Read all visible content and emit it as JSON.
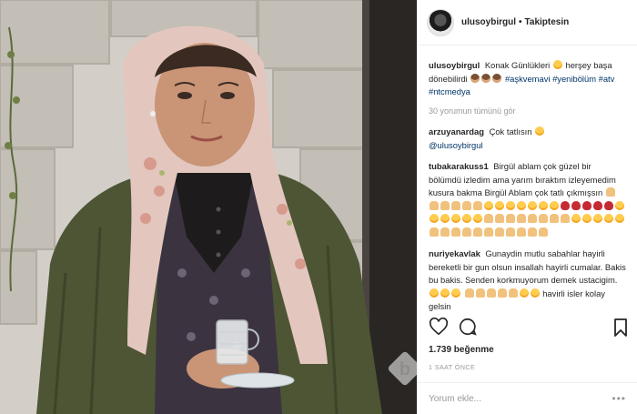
{
  "post": {
    "username": "ulusoybirgul",
    "dot": "•",
    "follow_status": "Takiptesin"
  },
  "caption": {
    "username": "ulusoybirgul",
    "text": "Konak Günlükleri",
    "text2": "herşey başa dönebilirdi",
    "tags": "#aşkvemavi #yenibölüm #atv #ntcmedya"
  },
  "view_all": "30 yorumun tümünü gör",
  "comments": [
    {
      "user": "arzuyanardag",
      "text": "Çok tatlısın",
      "mention": "@ulusoybirgul"
    },
    {
      "user": "tubakarakuss1",
      "text": "Birgül ablam çok güzel bir bölümdü izledim ama yarım bıraktım izleyemedim kusura bakma Birgül Ablam çok tatlı çıkmışsın"
    },
    {
      "user": "nuriyekavlak",
      "text": "Gunaydin mutlu sabahlar hayirli bereketli bir gun olsun insallah hayirli cumalar. Bakis bu bakis. Senden korkmuyorum demek ustacigim.",
      "text2": "havirli isler kolay gelsin"
    }
  ],
  "likes": "1.739 beğenme",
  "time": "1 SAAT ÖNCE",
  "comment_input": {
    "placeholder": "Yorum ekle..."
  },
  "more_symbol": "•••",
  "icons": [
    "heart-icon",
    "comment-icon",
    "bookmark-icon",
    "watermark-logo"
  ],
  "colors": {
    "link": "#003569",
    "muted": "#999999",
    "text": "#262626"
  }
}
